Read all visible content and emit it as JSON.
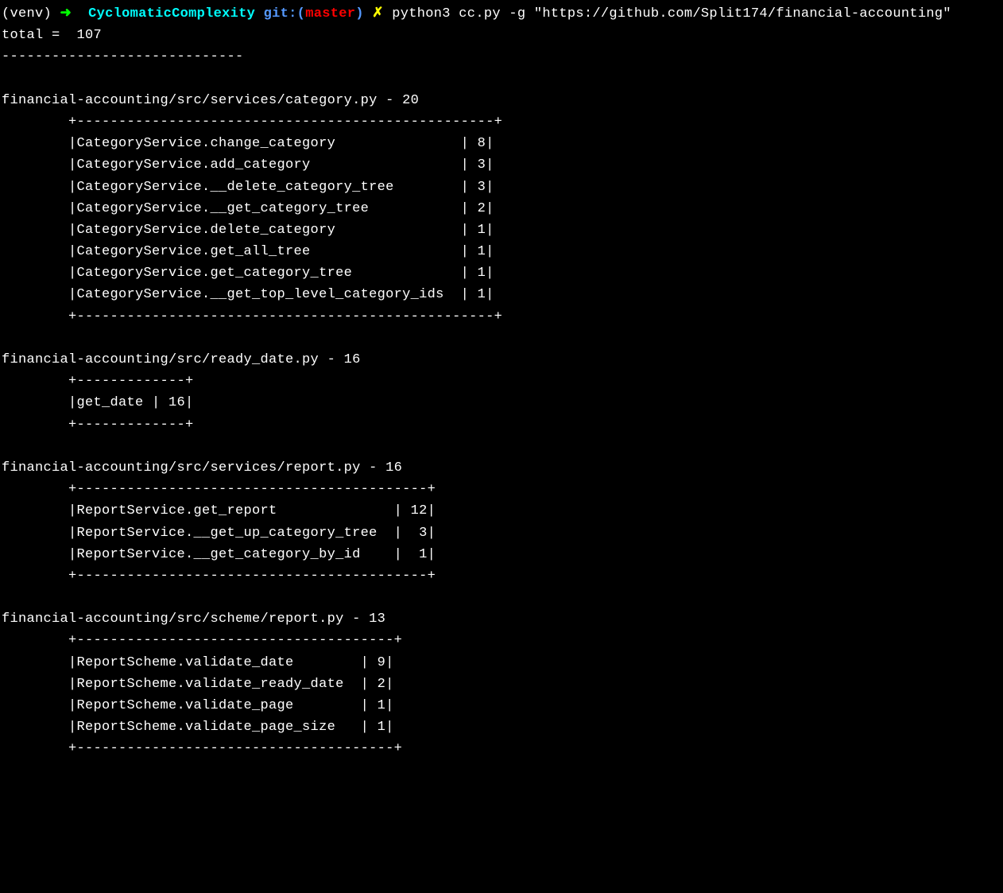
{
  "prompt": {
    "venv": "(venv)",
    "arrow": "➜",
    "directory": "CyclomaticComplexity",
    "git_label": "git:",
    "branch": "master",
    "dirty": "✗",
    "command": "python3 cc.py -g \"https://github.com/Split174/financial-accounting\""
  },
  "output": {
    "total_line": "total =  107",
    "divider": "-----------------------------",
    "files": [
      {
        "header": "financial-accounting/src/services/category.py - 20",
        "border_top": "        +--------------------------------------------------+",
        "rows": [
          "        |CategoryService.change_category               | 8|",
          "        |CategoryService.add_category                  | 3|",
          "        |CategoryService.__delete_category_tree        | 3|",
          "        |CategoryService.__get_category_tree           | 2|",
          "        |CategoryService.delete_category               | 1|",
          "        |CategoryService.get_all_tree                  | 1|",
          "        |CategoryService.get_category_tree             | 1|",
          "        |CategoryService.__get_top_level_category_ids  | 1|"
        ],
        "border_bottom": "        +--------------------------------------------------+"
      },
      {
        "header": "financial-accounting/src/ready_date.py - 16",
        "border_top": "        +-------------+",
        "rows": [
          "        |get_date | 16|"
        ],
        "border_bottom": "        +-------------+"
      },
      {
        "header": "financial-accounting/src/services/report.py - 16",
        "border_top": "        +------------------------------------------+",
        "rows": [
          "        |ReportService.get_report              | 12|",
          "        |ReportService.__get_up_category_tree  |  3|",
          "        |ReportService.__get_category_by_id    |  1|"
        ],
        "border_bottom": "        +------------------------------------------+"
      },
      {
        "header": "financial-accounting/src/scheme/report.py - 13",
        "border_top": "        +--------------------------------------+",
        "rows": [
          "        |ReportScheme.validate_date        | 9|",
          "        |ReportScheme.validate_ready_date  | 2|",
          "        |ReportScheme.validate_page        | 1|",
          "        |ReportScheme.validate_page_size   | 1|"
        ],
        "border_bottom": "        +--------------------------------------+"
      }
    ]
  }
}
